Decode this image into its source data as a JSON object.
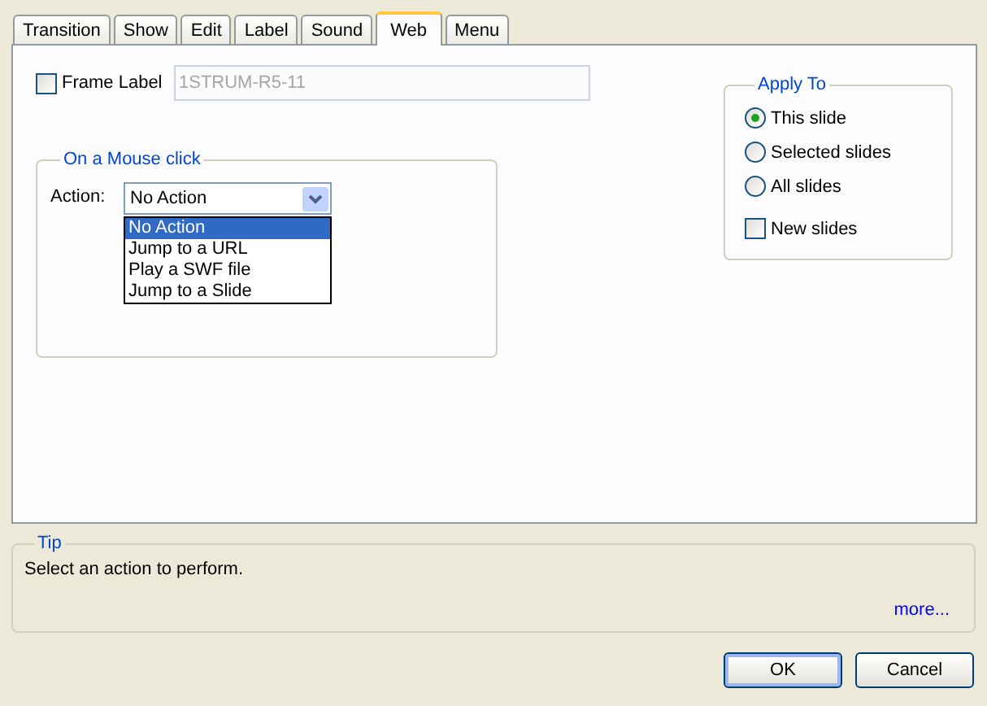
{
  "tabs": [
    {
      "label": "Transition",
      "selected": false
    },
    {
      "label": "Show",
      "selected": false
    },
    {
      "label": "Edit",
      "selected": false
    },
    {
      "label": "Label",
      "selected": false
    },
    {
      "label": "Sound",
      "selected": false
    },
    {
      "label": "Web",
      "selected": true
    },
    {
      "label": "Menu",
      "selected": false
    }
  ],
  "frame_label": {
    "label": "Frame Label",
    "checked": false,
    "value": "1STRUM-R5-11",
    "disabled": true
  },
  "mouse_click": {
    "title": "On a Mouse click",
    "action_label": "Action:",
    "action_value": "No Action",
    "options": [
      {
        "label": "No Action",
        "selected": true
      },
      {
        "label": "Jump to a URL",
        "selected": false
      },
      {
        "label": "Play a SWF file",
        "selected": false
      },
      {
        "label": "Jump to a Slide",
        "selected": false
      }
    ]
  },
  "apply_to": {
    "title": "Apply To",
    "options": [
      {
        "label": "This slide",
        "selected": true
      },
      {
        "label": "Selected slides",
        "selected": false
      },
      {
        "label": "All slides",
        "selected": false
      }
    ],
    "new_slides": {
      "label": "New slides",
      "checked": false
    }
  },
  "tip": {
    "title": "Tip",
    "text": "Select an action to perform.",
    "link": "more..."
  },
  "buttons": [
    {
      "label": "OK",
      "default": true
    },
    {
      "label": "Cancel",
      "default": false
    }
  ]
}
